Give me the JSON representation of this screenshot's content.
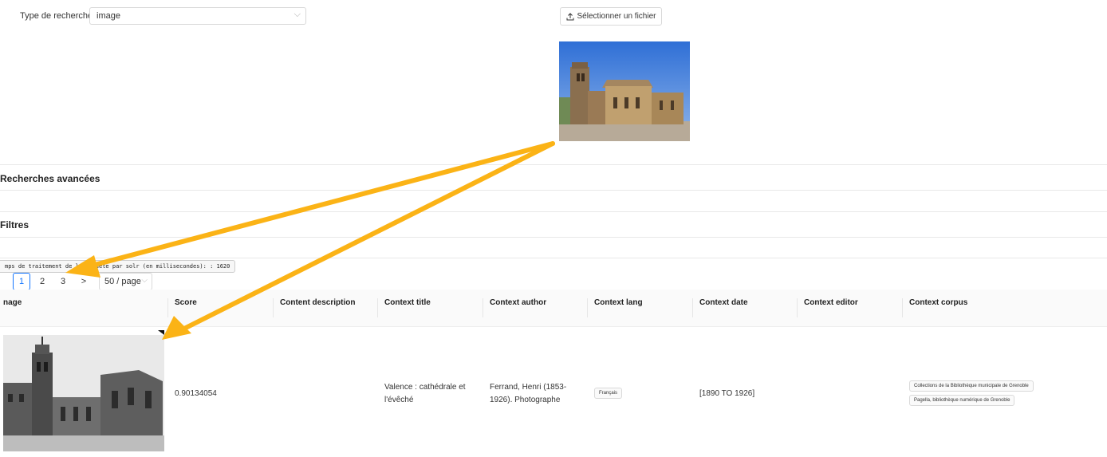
{
  "search": {
    "label": "Type de recherche :",
    "type_value": "image",
    "upload_label": "Sélectionner un fichier"
  },
  "sections": {
    "advanced": "Recherches avancées",
    "filters": "Filtres"
  },
  "timing_text": "mps de traitement de la requête par solr (en millisecondes): : 1620",
  "pagination": {
    "pages": [
      "1",
      "2",
      "3"
    ],
    "next": ">",
    "per_page": "50 / page"
  },
  "table": {
    "headers": [
      "nage",
      "Score",
      "Content description",
      "Context title",
      "Context author",
      "Context lang",
      "Context date",
      "Context editor",
      "Context corpus"
    ],
    "row": {
      "score": "0.90134054",
      "description": "",
      "title_line1": "Valence : cathédrale et",
      "title_line2": "l'évêché",
      "author_line1": "Ferrand, Henri (1853-",
      "author_line2": "1926). Photographe",
      "lang": "Français",
      "date": "[1890 TO 1926]",
      "editor": "",
      "corpus": [
        "Collections de la Bibliothèque municipale de Grenoble",
        "Pagella, bibliothèque numérique de Grenoble"
      ]
    }
  },
  "colors": {
    "accent": "#1677ff",
    "arrow": "#fbb316"
  }
}
